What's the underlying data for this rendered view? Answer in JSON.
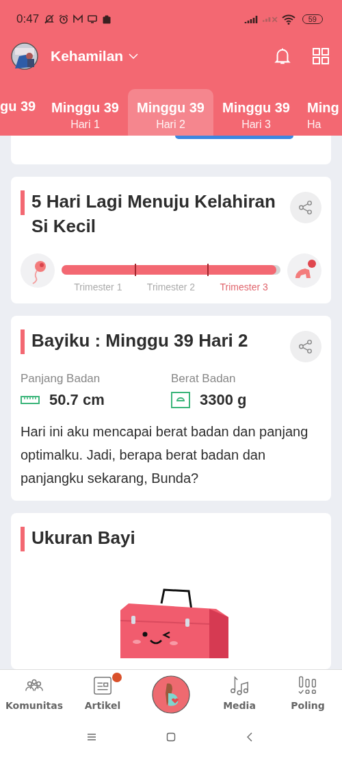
{
  "status_bar": {
    "time": "0:47",
    "battery": "59"
  },
  "header": {
    "title": "Kehamilan"
  },
  "tabs": [
    {
      "week": "gu 39",
      "selected": false
    },
    {
      "week": "Minggu 39",
      "day": "Hari 1",
      "selected": false
    },
    {
      "week": "Minggu 39",
      "day": "Hari 2",
      "selected": true
    },
    {
      "week": "Minggu 39",
      "day": "Hari 3",
      "selected": false
    },
    {
      "week": "Ming",
      "day": "Ha",
      "selected": false
    }
  ],
  "countdown_card": {
    "title": "5 Hari Lagi Menuju Kelahiran Si Kecil",
    "progress": {
      "level": 0.98
    },
    "trimesters": [
      {
        "label": "Trimester 1",
        "selected": false
      },
      {
        "label": "Trimester 2",
        "selected": false
      },
      {
        "label": "Trimester 3",
        "selected": true
      }
    ]
  },
  "baby_card": {
    "title": "Bayiku : Minggu 39 Hari 2",
    "stats": [
      {
        "kind": "length",
        "label": "Panjang Badan",
        "value": "50.7 cm"
      },
      {
        "kind": "weight",
        "label": "Berat Badan",
        "value": "3300 g"
      }
    ],
    "description": "Hari ini aku mencapai berat badan dan panjang optimalku. Jadi, berapa berat badan dan panjangku sekarang, Bunda?"
  },
  "size_card": {
    "title": "Ukuran Bayi"
  },
  "bottom_nav": [
    {
      "kind": "community",
      "label": "Komunitas",
      "badge": false
    },
    {
      "kind": "article",
      "label": "Artikel",
      "badge": true
    },
    {
      "kind": "pregnancy"
    },
    {
      "kind": "media",
      "label": "Media",
      "badge": false
    },
    {
      "kind": "poll",
      "label": "Poling",
      "badge": false
    }
  ]
}
